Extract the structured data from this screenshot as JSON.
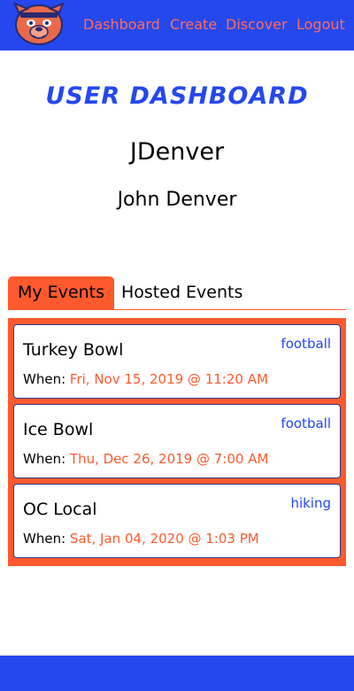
{
  "nav": {
    "logo_icon": "dog-mascot-logo-icon",
    "links": [
      {
        "label": "Dashboard"
      },
      {
        "label": "Create"
      },
      {
        "label": "Discover"
      },
      {
        "label": "Logout"
      }
    ]
  },
  "dashboard": {
    "title": "USER DASHBOARD",
    "username": "JDenver",
    "full_name": "John Denver"
  },
  "tabs": [
    {
      "label": "My Events",
      "active": true
    },
    {
      "label": "Hosted Events",
      "active": false
    }
  ],
  "events": [
    {
      "name": "Turkey Bowl",
      "tag": "football",
      "when_label": "When:",
      "date": "Fri, Nov 15, 2019 @ 11:20 AM"
    },
    {
      "name": "Ice Bowl",
      "tag": "football",
      "when_label": "When:",
      "date": "Thu, Dec 26, 2019 @ 7:00 AM"
    },
    {
      "name": "OC Local",
      "tag": "hiking",
      "when_label": "When:",
      "date": "Sat, Jan 04, 2020 @ 1:03 PM"
    }
  ],
  "colors": {
    "brand_blue": "#2448ee",
    "accent_orange": "#ff5a2e",
    "nav_link": "#ff6b5b"
  }
}
